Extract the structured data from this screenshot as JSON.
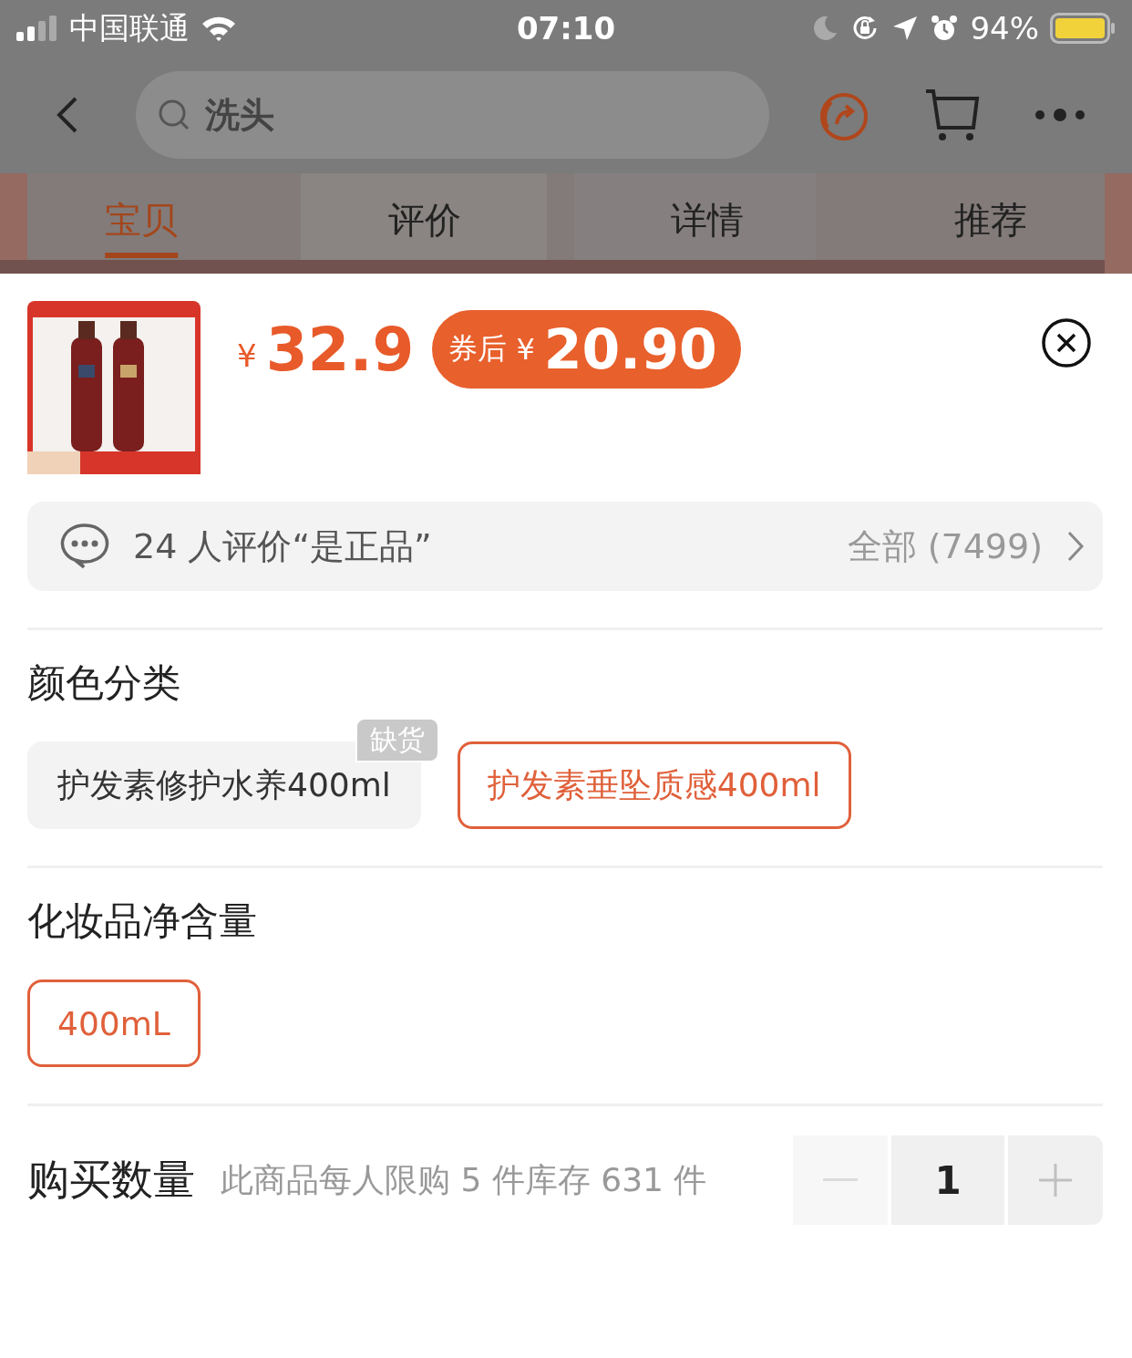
{
  "status_bar": {
    "carrier": "中国联通",
    "time": "07:10",
    "battery": "94%"
  },
  "nav": {
    "search_query": "洗头"
  },
  "tabs": [
    {
      "label": "宝贝",
      "selected": true
    },
    {
      "label": "评价",
      "selected": false
    },
    {
      "label": "详情",
      "selected": false
    },
    {
      "label": "推荐",
      "selected": false
    }
  ],
  "product": {
    "currency": "¥",
    "price": "32.9",
    "coupon": {
      "label": "券后",
      "currency": "¥",
      "price": "20.90"
    }
  },
  "reviews": {
    "summary": "24 人评价“是正品”",
    "all": "全部 (7499)"
  },
  "sections": [
    {
      "title": "颜色分类",
      "options": [
        {
          "label": "护发素修护水养400ml",
          "selected": false,
          "badge": "缺货"
        },
        {
          "label": "护发素垂坠质感400ml",
          "selected": true
        }
      ]
    },
    {
      "title": "化妆品净含量",
      "options": [
        {
          "label": "400mL",
          "selected": true
        }
      ]
    }
  ],
  "quantity": {
    "label": "购买数量",
    "note": "此商品每人限购 5 件库存 631 件",
    "value": "1",
    "minus_disabled": true
  }
}
